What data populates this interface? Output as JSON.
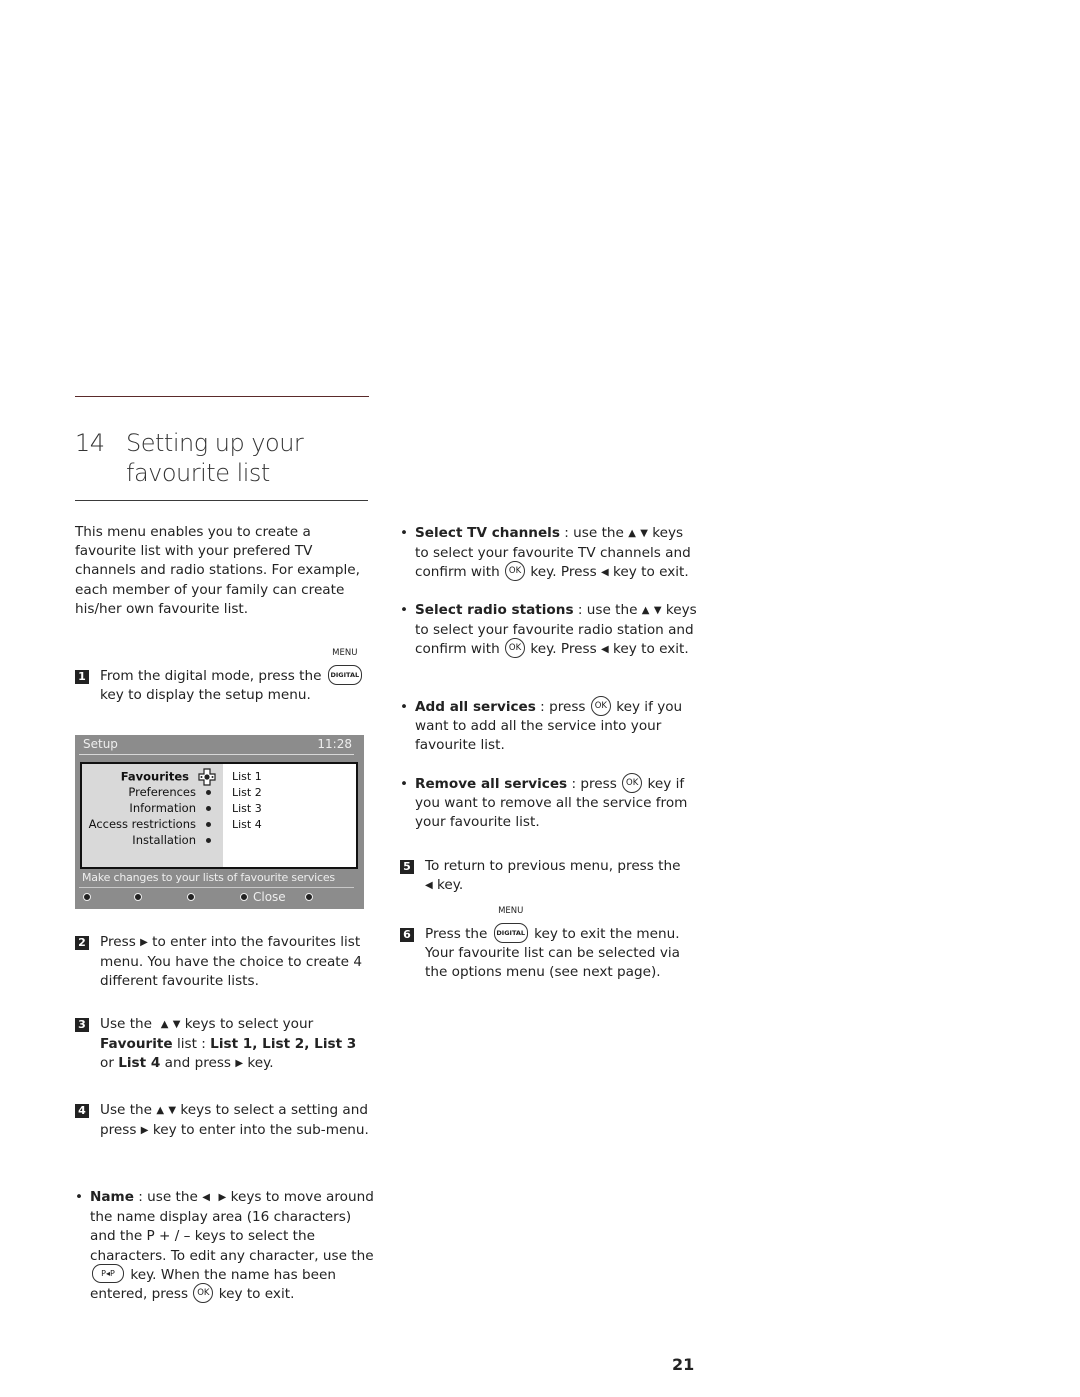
{
  "chapter": {
    "number": "14",
    "title": "Setting up your favourite list"
  },
  "intro": "This menu enables you to create a favourite list with your prefered TV channels and radio stations. For example, each member of your family can create his/her own favourite list.",
  "keys": {
    "menu_label": "MENU",
    "digital_label": "DIGITAL",
    "ok_label": "OK",
    "pp_label": "P◂P",
    "up": "▲",
    "down": "▼",
    "left": "◀",
    "right": "▶"
  },
  "steps": [
    {
      "num": "1",
      "a": "From the digital mode, press the",
      "b": "key to display the setup menu."
    },
    {
      "num": "2",
      "a": "Press",
      "b": "to enter into the favourites list menu. You have the choice to create 4 different favourite lists."
    },
    {
      "num": "3",
      "a": "Use the",
      "b": "keys to select your",
      "bold1": "Favourite",
      "c": "list :",
      "bold2": "List 1, List 2, List 3",
      "d": "or",
      "bold3": "List 4",
      "e": "and press",
      "f": "key."
    },
    {
      "num": "4",
      "a": "Use the",
      "b": "keys to select a setting and press",
      "c": "key to enter into the sub-menu."
    },
    {
      "num": "5",
      "a": "To return to previous menu, press the",
      "b": "key."
    },
    {
      "num": "6",
      "a": "Press the",
      "b": "key to exit the menu. Your favourite list can be selected via the options menu (see next page)."
    }
  ],
  "tv_menu": {
    "title": "Setup",
    "clock": "11:28",
    "items": [
      "Favourites",
      "Preferences",
      "Information",
      "Access restrictions",
      "Installation"
    ],
    "selected": "Favourites",
    "lists": [
      "List 1",
      "List 2",
      "List 3",
      "List 4"
    ],
    "hint": "Make changes to your lists of favourite services",
    "close_label": "Close"
  },
  "bullets": {
    "name": {
      "bold": "Name",
      "a": ": use the",
      "b": "keys to move around the name display area (16 characters) and the  P + / – keys to select the characters. To edit any character, use the",
      "c": "key.  When the name has been entered, press",
      "d": "key to exit."
    },
    "tv": {
      "bold": "Select TV channels",
      "a": ": use the",
      "b": "keys to select your favourite TV channels and confirm with",
      "c": "key. Press",
      "d": "key to exit."
    },
    "radio": {
      "bold": "Select radio stations",
      "a": ": use the",
      "b": "keys to select your favourite radio station and confirm with",
      "c": "key. Press",
      "d": "key to exit."
    },
    "add": {
      "bold": "Add all services",
      "a": ": press",
      "b": "key if you want to add all the service into your favourite list."
    },
    "remove": {
      "bold": "Remove all services",
      "a": ": press",
      "b": "key if you want to remove all the service from your favourite list."
    }
  },
  "page_number": "21"
}
